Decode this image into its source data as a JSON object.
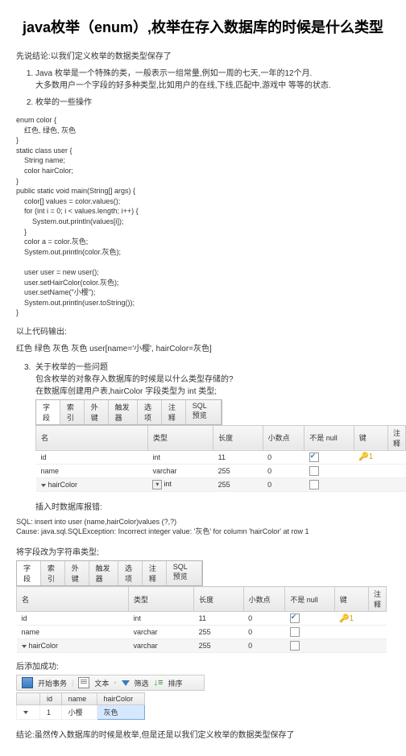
{
  "title": "java枚举（enum）,枚举在存入数据库的时候是什么类型",
  "intro": "先说结论:以我们定义枚举的数据类型保存了",
  "li1": "Java 枚举是一个特殊的类，一般表示一组常量,例如一周的七天,一年的12个月.",
  "li1b": "大多数用户一个字段的好多种类型,比如用户的在线,下线,匹配中,游戏中 等等的状态.",
  "li2": "枚举的一些操作",
  "code": "enum color {\n    红色, 绿色, 灰色\n}\nstatic class user {\n    String name;\n    color hairColor;\n}\npublic static void main(String[] args) {\n    color[] values = color.values();\n    for (int i = 0; i < values.length; i++) {\n        System.out.println(values[i]);\n    }\n    color a = color.灰色;\n    System.out.println(color.灰色);\n\n    user user = new user();\n    user.setHairColor(color.灰色);\n    user.setName(\"小樱\");\n    System.out.println(user.toString());\n}",
  "outlabel": "以上代码输出:",
  "redline": "红色 绿色 灰色 灰色 user[name='小樱', hairColor=灰色]",
  "q3num": "3.",
  "q3a": "关于枚举的一些问题",
  "q3b": "包含枚举的对象存入数据库的时候是以什么类型存储的?",
  "q3c": "在数据库创建用户表,hairColor 字段类型为 int 类型;",
  "tabs": [
    "字段",
    "索引",
    "外键",
    "触发器",
    "选项",
    "注释",
    "SQL 预览"
  ],
  "thead": [
    "名",
    "类型",
    "长度",
    "小数点",
    "不是 null",
    "键",
    "注释"
  ],
  "rows": [
    {
      "name": "id",
      "type": "int",
      "len": "11",
      "dec": "0",
      "nn": true,
      "key": true
    },
    {
      "name": "name",
      "type": "varchar",
      "len": "255",
      "dec": "0",
      "nn": false,
      "key": false
    },
    {
      "name": "hairColor",
      "type": "int",
      "len": "255",
      "dec": "0",
      "nn": false,
      "key": false,
      "sel": true,
      "dd": true
    }
  ],
  "insertlabel": "插入时数据库报错:",
  "err1": "SQL: insert into user (name,hairColor)values (?,?)",
  "err2": "  Cause: java.sql.SQLException: Incorrect integer value: '灰色' for column 'hairColor' at row 1",
  "changelabel": "将字段改为字符串类型;",
  "rows2": [
    {
      "name": "id",
      "type": "int",
      "len": "11",
      "dec": "0",
      "nn": true,
      "key": true
    },
    {
      "name": "name",
      "type": "varchar",
      "len": "255",
      "dec": "0",
      "nn": false,
      "key": false
    },
    {
      "name": "hairColor",
      "type": "varchar",
      "len": "255",
      "dec": "0",
      "nn": false,
      "key": false,
      "sel": true
    }
  ],
  "successlabel": "后添加成功:",
  "toolbar": {
    "begin": "开始事务",
    "text": "文本",
    "filter": "筛选",
    "sort": "排序"
  },
  "rthead": [
    "id",
    "name",
    "hairColor"
  ],
  "rrow": [
    "1",
    "小樱",
    "灰色"
  ],
  "final": "结论:虽然传入数据库的时候是枚举,但是还是以我们定义枚举的数据类型保存了"
}
